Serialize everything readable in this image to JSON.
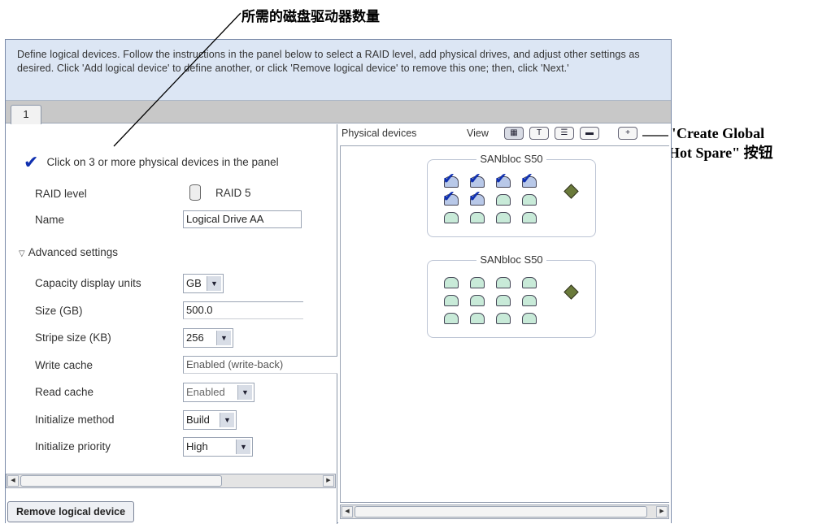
{
  "annotations": {
    "top": "所需的磁盘驱动器数量",
    "right_line1": "\"Create Global",
    "right_line2": "Hot Spare\" 按钮"
  },
  "instructions": "Define logical devices.  Follow the instructions in the panel below to select a RAID level, add physical drives, and adjust other settings as desired.  Click 'Add logical device' to define another, or click 'Remove logical device' to remove this one; then, click 'Next.'",
  "tabs": [
    {
      "label": "1"
    }
  ],
  "left": {
    "prompt": "Click on 3 or more physical devices in the panel",
    "raid_level_label": "RAID level",
    "raid_level_value": "RAID 5",
    "name_label": "Name",
    "name_value": "Logical Drive AA",
    "advanced_label": "Advanced settings",
    "capacity_units_label": "Capacity display units",
    "capacity_units_value": "GB",
    "size_label": "Size (GB)",
    "size_value": "500.0",
    "stripe_label": "Stripe size (KB)",
    "stripe_value": "256",
    "write_cache_label": "Write cache",
    "write_cache_value": "Enabled (write-back)",
    "read_cache_label": "Read cache",
    "read_cache_value": "Enabled",
    "init_method_label": "Initialize method",
    "init_method_value": "Build",
    "init_priority_label": "Initialize priority",
    "init_priority_value": "High",
    "remove_button": "Remove logical device"
  },
  "right": {
    "title": "Physical devices",
    "view_label": "View",
    "view_buttons": [
      "enclosure-view-icon",
      "text-view-icon",
      "list-view-icon",
      "size-view-icon"
    ],
    "hot_spare_button_icon": "plus-icon",
    "enclosures": [
      {
        "name": "SANbloc S50",
        "selected_disks": 6,
        "total_disks": 12
      },
      {
        "name": "SANbloc S50",
        "selected_disks": 0,
        "total_disks": 12
      }
    ]
  },
  "colors": {
    "instruction_bg": "#dce6f4",
    "check_blue": "#1030b0",
    "disk_green": "#c8ead8"
  }
}
